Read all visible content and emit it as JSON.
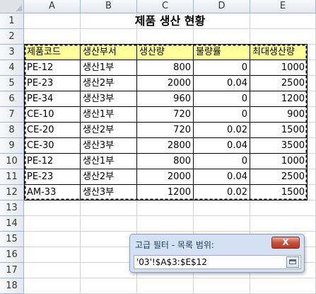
{
  "columns": [
    "A",
    "B",
    "C",
    "D",
    "E"
  ],
  "rows": [
    "1",
    "2",
    "3",
    "4",
    "5",
    "6",
    "7",
    "8",
    "9",
    "10",
    "11",
    "12",
    "13",
    "14",
    "15",
    "16",
    "17",
    "18"
  ],
  "title": "제품 생산 현황",
  "table": {
    "headers": [
      "제품코드",
      "생산부서",
      "생산량",
      "불량률",
      "최대생산량"
    ],
    "rows": [
      [
        "PE-12",
        "생산1부",
        "800",
        "0",
        "1000"
      ],
      [
        "PE-23",
        "생산2부",
        "2000",
        "0.04",
        "2500"
      ],
      [
        "PE-34",
        "생산3부",
        "960",
        "0",
        "1200"
      ],
      [
        "CE-10",
        "생산1부",
        "720",
        "0",
        "900"
      ],
      [
        "CE-20",
        "생산2부",
        "720",
        "0.02",
        "1500"
      ],
      [
        "CE-30",
        "생산3부",
        "2800",
        "0.04",
        "3500"
      ],
      [
        "PE-12",
        "생산1부",
        "800",
        "0",
        "1000"
      ],
      [
        "PE-23",
        "생산2부",
        "2000",
        "0.04",
        "2500"
      ],
      [
        "AM-33",
        "생산3부",
        "1200",
        "0.02",
        "1500"
      ]
    ]
  },
  "dialog": {
    "title": "고급 필터 - 목록 범위:",
    "close_label": "X",
    "input_value": "'03'!$A$3:$E$12"
  },
  "colors": {
    "header_fill": "#ffff99",
    "row_header_selected": "#f1c15f"
  }
}
